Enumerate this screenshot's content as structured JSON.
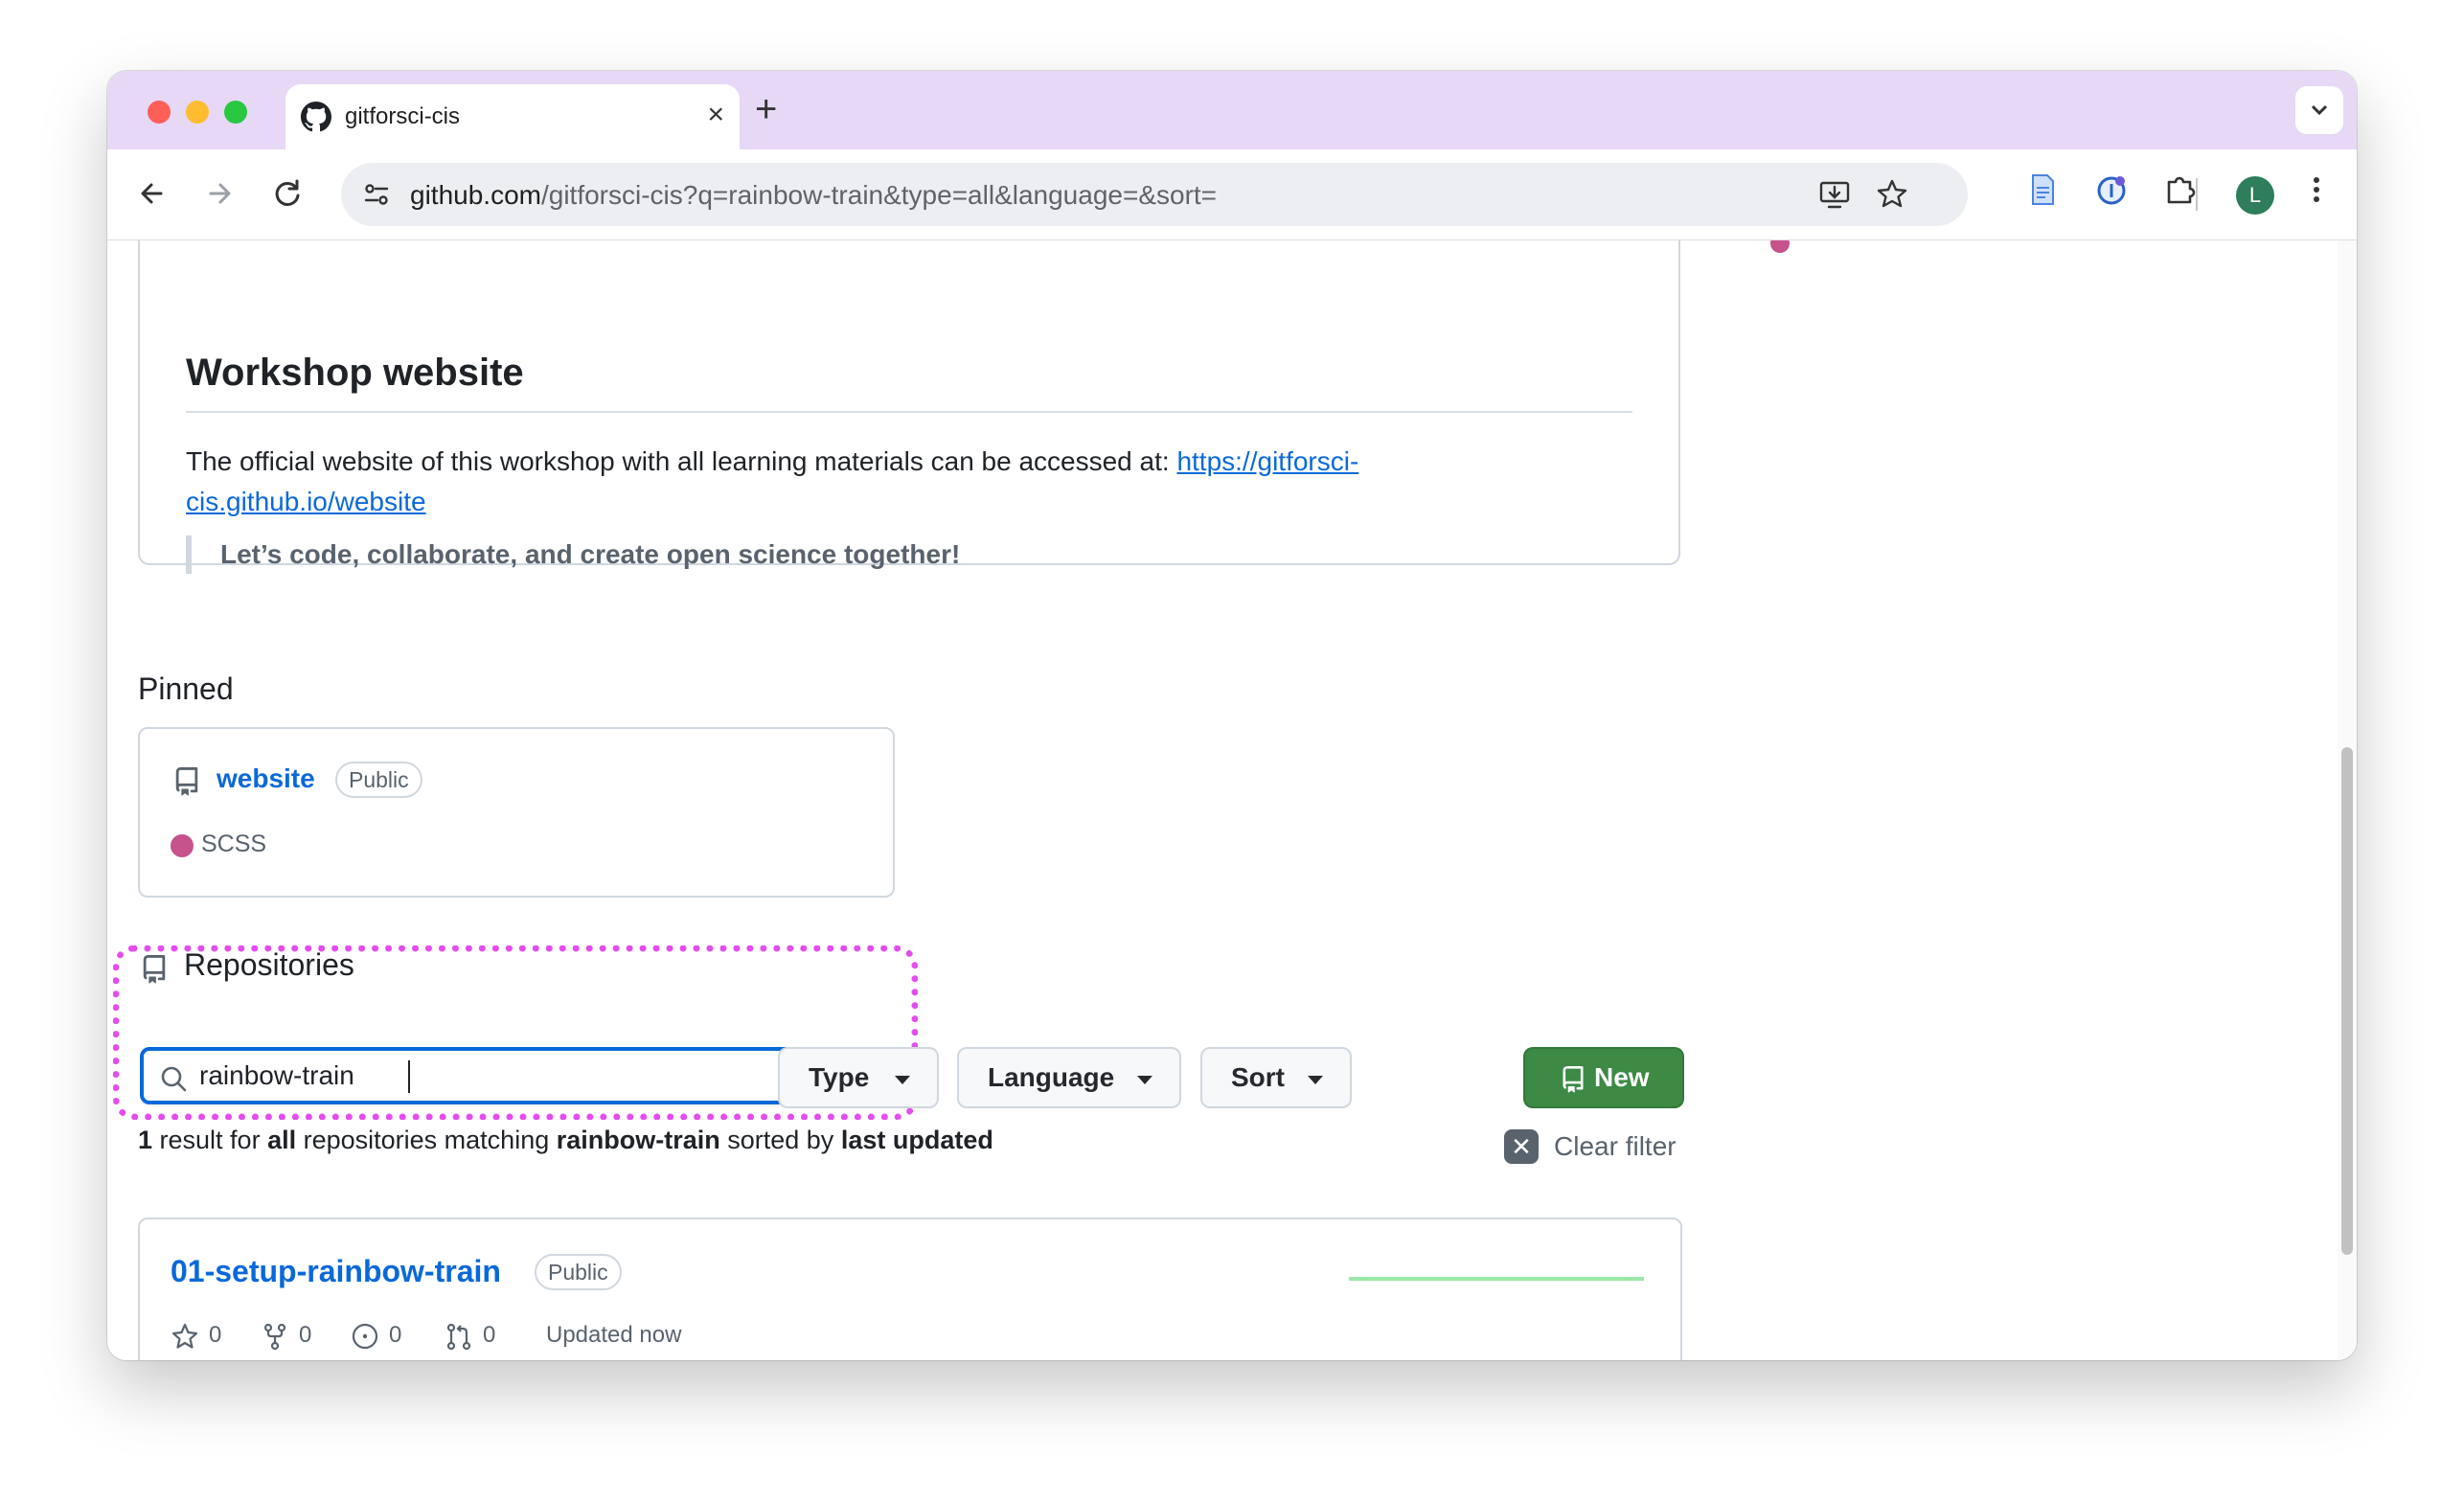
{
  "browser": {
    "tab_title": "gitforsci-cis",
    "url_host": "github.com",
    "url_path": "/gitforsci-cis?q=rainbow-train&type=all&language=&sort=",
    "profile_initial": "L"
  },
  "readme": {
    "title": "Workshop website",
    "paragraph": "The official website of this workshop with all learning materials can be accessed at: ",
    "link_text": "https://gitforsci-cis.github.io/website",
    "quote": "Let’s code, collaborate, and create open science together!"
  },
  "pinned": {
    "label": "Pinned",
    "repo_name": "website",
    "visibility": "Public",
    "language": "SCSS",
    "language_color": "#c6538c"
  },
  "repositories": {
    "title": "Repositories",
    "search_value": "rainbow-train",
    "type_label": "Type",
    "language_label": "Language",
    "sort_label": "Sort",
    "new_label": "New",
    "result_count": "1",
    "result_text_1": " result for ",
    "result_type": "all",
    "result_text_2": " repositories matching ",
    "result_query": "rainbow-train",
    "result_text_3": " sorted by ",
    "result_sort": "last updated",
    "clear_filter": "Clear filter"
  },
  "result_repo": {
    "name": "01-setup-rainbow-train",
    "visibility": "Public",
    "stars": "0",
    "forks": "0",
    "issues": "0",
    "pulls": "0",
    "updated": "Updated now"
  },
  "colors": {
    "accent_link": "#0969da",
    "new_button": "#3c8a44",
    "highlight": "#e54cf0",
    "tab_strip": "#e7d8f6"
  }
}
